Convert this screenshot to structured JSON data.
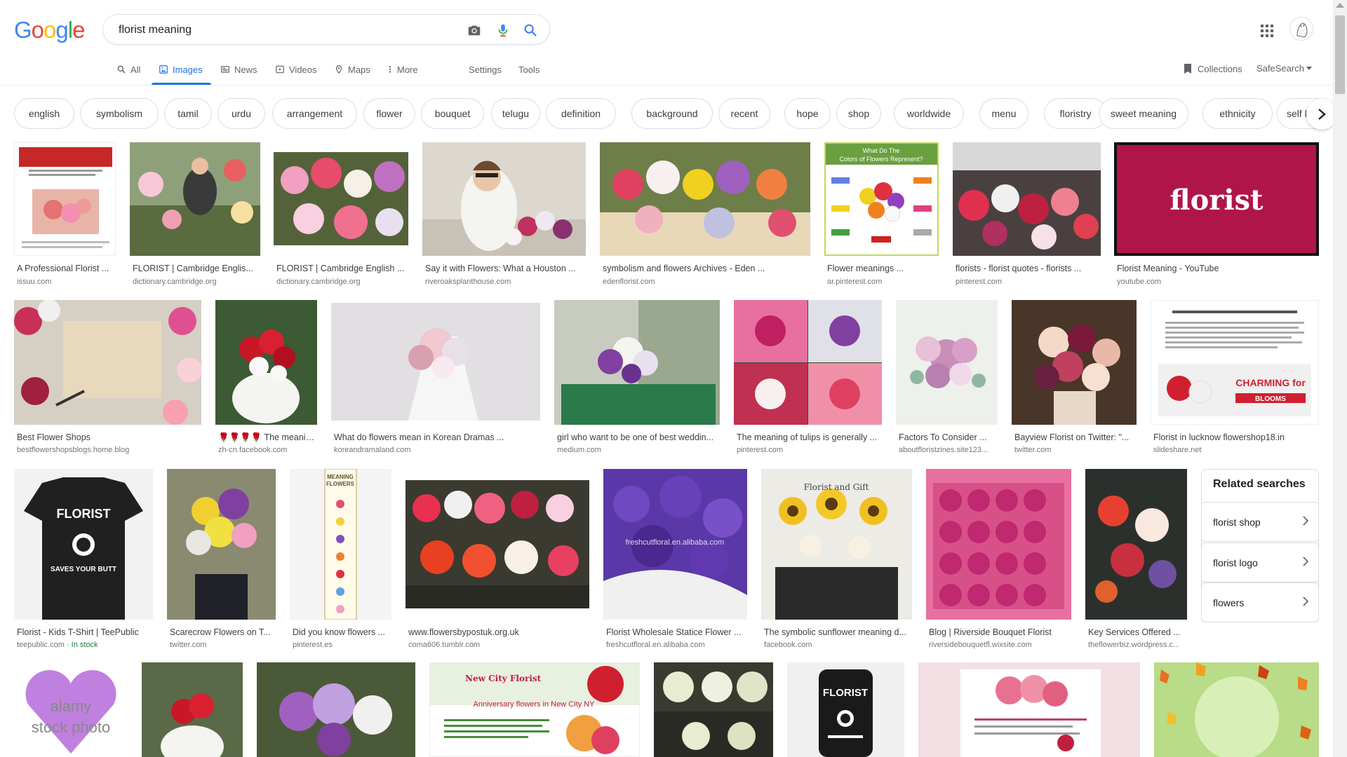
{
  "logo_text": [
    "G",
    "o",
    "o",
    "g",
    "l",
    "e"
  ],
  "logo_colors": [
    "#4285f4",
    "#ea4335",
    "#fbbc05",
    "#4285f4",
    "#34a853",
    "#ea4335"
  ],
  "search": {
    "value": "florist meaning"
  },
  "icons": {
    "camera": "camera-icon",
    "mic": "mic-icon",
    "search": "search-icon",
    "apps": "apps-grid-icon",
    "avatar": "avatar"
  },
  "tabs": [
    {
      "label": "All"
    },
    {
      "label": "Images"
    },
    {
      "label": "News"
    },
    {
      "label": "Videos"
    },
    {
      "label": "Maps"
    },
    {
      "label": "More"
    },
    {
      "label": "Settings"
    },
    {
      "label": "Tools"
    }
  ],
  "right_tabs": {
    "collections": "Collections",
    "safesearch": "SafeSearch"
  },
  "chips": [
    "english",
    "symbolism",
    "tamil",
    "urdu",
    "arrangement",
    "flower",
    "bouquet",
    "telugu",
    "definition",
    "background",
    "recent",
    "hope",
    "shop",
    "worldwide",
    "menu",
    "floristry",
    "sweet meaning",
    "ethnicity",
    "self love"
  ],
  "results": [
    {
      "title": "A Professional Florist ...",
      "source": "issuu.com"
    },
    {
      "title": "FLORIST | Cambridge Englis...",
      "source": "dictionary.cambridge.org"
    },
    {
      "title": "FLORIST | Cambridge English ...",
      "source": "dictionary.cambridge.org"
    },
    {
      "title": "Say it with Flowers: What a Houston ...",
      "source": "riveroaksplanthouse.com"
    },
    {
      "title": "symbolism and flowers Archives - Eden ...",
      "source": "edenflorist.com"
    },
    {
      "title": "Flower meanings ...",
      "source": "ar.pinterest.com"
    },
    {
      "title": "florists - florist quotes - florists ...",
      "source": "pinterest.com"
    },
    {
      "title": "Florist Meaning - YouTube",
      "source": "youtube.com"
    },
    {
      "title": "Best Flower Shops",
      "source": "bestflowershopsblogs.home.blog"
    },
    {
      "title": "🌹🌹🌹🌹 The meanin...",
      "source": "zh-cn.facebook.com"
    },
    {
      "title": "What do flowers mean in Korean Dramas ...",
      "source": "koreandramaland.com"
    },
    {
      "title": "girl who want to be one of best weddin...",
      "source": "medium.com"
    },
    {
      "title": "The meaning of tulips is generally ...",
      "source": "pinterest.com"
    },
    {
      "title": "Factors To Consider ...",
      "source": "aboutfloristzines.site123..."
    },
    {
      "title": "Bayview Florist  on Twitter: \"...",
      "source": "twitter.com"
    },
    {
      "title": "Florist in lucknow flowershop18.in",
      "source": "slideshare.net"
    },
    {
      "title": "Florist - Kids T-Shirt | TeePublic",
      "source": "teepublic.com",
      "stock": "In stock"
    },
    {
      "title": "Scarecrow Flowers on T...",
      "source": "twitter.com"
    },
    {
      "title": "Did you know flowers ...",
      "source": "pinterest.es"
    },
    {
      "title": "www.flowersbypostuk.org.uk",
      "source": "coma606.tumblr.com"
    },
    {
      "title": "Florist Wholesale Statice Flower ...",
      "source": "freshcutfloral.en.alibaba.com"
    },
    {
      "title": "The symbolic sunflower meaning d...",
      "source": "facebook.com"
    },
    {
      "title": "Blog | Riverside Bouquet Florist",
      "source": "riversidebouquetfl.wixsite.com"
    },
    {
      "title": "Key Services Offered ...",
      "source": "theflowerbiz.wordpress.c..."
    }
  ],
  "overlay_text": {
    "youtube_word": "florist",
    "colors_title": "What Do The Colors of Flowers Represent?",
    "tshirt_word": "FLORIST",
    "tshirt_sub": "SAVES YOUR BUTT",
    "meaning_flowers": "MEANING FLOWERS",
    "charming": "CHARMING for BLOOMS",
    "alibaba_mark": "freshcutfloral.en.alibaba.com",
    "alamy": "alamy stock photo",
    "newcity": "New City Florist",
    "anniversary": "Anniversary flowers in New City NY",
    "phone_word": "FLORIST",
    "sunflower_sign": "Florist and Gift"
  },
  "related": {
    "heading": "Related searches",
    "items": [
      "florist shop",
      "florist logo",
      "flowers"
    ]
  },
  "colors": {
    "accent": "#1a73e8",
    "text_secondary": "#70757a",
    "chip_border": "#dadce0",
    "stock_green": "#188038"
  }
}
